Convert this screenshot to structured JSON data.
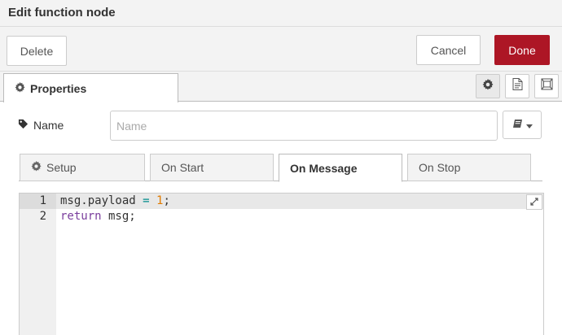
{
  "dialog": {
    "title": "Edit function node"
  },
  "toolbar": {
    "delete_label": "Delete",
    "cancel_label": "Cancel",
    "done_label": "Done"
  },
  "tabs": {
    "properties_label": "Properties",
    "side_icons": [
      "gear-icon",
      "document-icon",
      "frame-icon"
    ]
  },
  "name_field": {
    "label": "Name",
    "placeholder": "Name",
    "value": ""
  },
  "subtabs": [
    {
      "label": "Setup",
      "icon": "gear-icon",
      "active": false
    },
    {
      "label": "On Start",
      "active": false
    },
    {
      "label": "On Message",
      "active": true
    },
    {
      "label": "On Stop",
      "active": false
    }
  ],
  "editor": {
    "line_numbers": [
      "1",
      "2"
    ],
    "lines": [
      {
        "ident": "msg.payload",
        "op": " = ",
        "num": "1",
        "end": ";"
      },
      {
        "kw": "return",
        "rest": " msg;"
      }
    ]
  },
  "colors": {
    "done_button": "#ad1625",
    "keyword": "#7a3e9d",
    "number": "#e07b00",
    "operator": "#008b8b"
  }
}
